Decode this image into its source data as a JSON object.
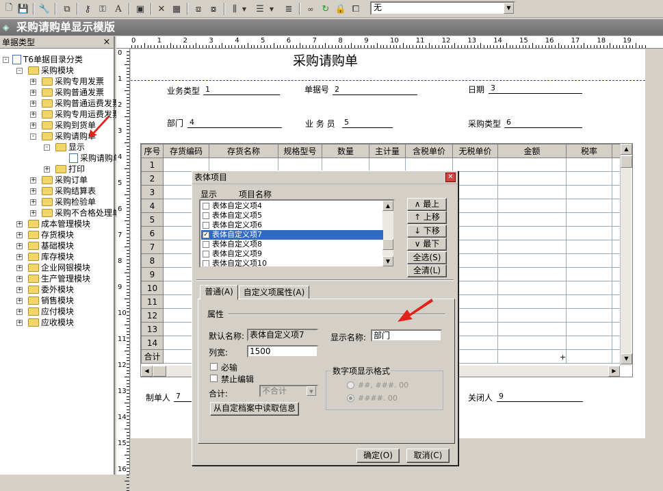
{
  "toolbar": {
    "combo_value": "无"
  },
  "window": {
    "title": "采购请购单显示模版"
  },
  "left_panel": {
    "header": "单据类型",
    "close_label": "×",
    "tree": [
      {
        "label": "T6单据目录分类",
        "level": 0,
        "type": "doc",
        "expand": "-"
      },
      {
        "label": "采购模块",
        "level": 1,
        "type": "folder",
        "expand": "-"
      },
      {
        "label": "采购专用发票",
        "level": 2,
        "type": "folder",
        "expand": "+"
      },
      {
        "label": "采购普通发票",
        "level": 2,
        "type": "folder",
        "expand": "+"
      },
      {
        "label": "采购普通运费发票",
        "level": 2,
        "type": "folder",
        "expand": "+"
      },
      {
        "label": "采购专用运费发票",
        "level": 2,
        "type": "folder",
        "expand": "+"
      },
      {
        "label": "采购到货单",
        "level": 2,
        "type": "folder",
        "expand": "+"
      },
      {
        "label": "采购请购单",
        "level": 2,
        "type": "folder",
        "expand": "-"
      },
      {
        "label": "显示",
        "level": 3,
        "type": "folder",
        "expand": "-"
      },
      {
        "label": "采购请购单",
        "level": 4,
        "type": "doc",
        "expand": ""
      },
      {
        "label": "打印",
        "level": 3,
        "type": "folder",
        "expand": "+"
      },
      {
        "label": "采购订单",
        "level": 2,
        "type": "folder",
        "expand": "+"
      },
      {
        "label": "采购结算表",
        "level": 2,
        "type": "folder",
        "expand": "+"
      },
      {
        "label": "采购检验单",
        "level": 2,
        "type": "folder",
        "expand": "+"
      },
      {
        "label": "采购不合格处理单",
        "level": 2,
        "type": "folder",
        "expand": "+"
      },
      {
        "label": "成本管理模块",
        "level": 1,
        "type": "folder",
        "expand": "+"
      },
      {
        "label": "存货模块",
        "level": 1,
        "type": "folder",
        "expand": "+"
      },
      {
        "label": "基础模块",
        "level": 1,
        "type": "folder",
        "expand": "+"
      },
      {
        "label": "库存模块",
        "level": 1,
        "type": "folder",
        "expand": "+"
      },
      {
        "label": "企业网银模块",
        "level": 1,
        "type": "folder",
        "expand": "+"
      },
      {
        "label": "生产管理模块",
        "level": 1,
        "type": "folder",
        "expand": "+"
      },
      {
        "label": "委外模块",
        "level": 1,
        "type": "folder",
        "expand": "+"
      },
      {
        "label": "销售模块",
        "level": 1,
        "type": "folder",
        "expand": "+"
      },
      {
        "label": "应付模块",
        "level": 1,
        "type": "folder",
        "expand": "+"
      },
      {
        "label": "应收模块",
        "level": 1,
        "type": "folder",
        "expand": "+"
      }
    ]
  },
  "ruler": {
    "top": [
      "0",
      "1",
      "2",
      "3",
      "4",
      "5",
      "6",
      "7",
      "8",
      "9",
      "10",
      "11",
      "12",
      "13",
      "14",
      "15",
      "16",
      "17",
      "18",
      "19"
    ],
    "left": [
      "0",
      "1",
      "2",
      "3",
      "4",
      "5",
      "6",
      "7",
      "8",
      "9",
      "10",
      "11",
      "12",
      "13",
      "14",
      "15",
      "16"
    ]
  },
  "form": {
    "title": "采购请购单",
    "header_fields": [
      {
        "label": "业务类型",
        "value": "1"
      },
      {
        "label": "单据号",
        "value": "2"
      },
      {
        "label": "日期",
        "value": "3"
      },
      {
        "label": "部门",
        "value": "4"
      },
      {
        "label": "业 务 员",
        "value": "5"
      },
      {
        "label": "采购类型",
        "value": "6"
      }
    ],
    "columns": [
      "序号",
      "存货编码",
      "存货名称",
      "规格型号",
      "数量",
      "主计量",
      "含税单价",
      "无税单价",
      "金额",
      "税率"
    ],
    "row_numbers": [
      "1",
      "2",
      "3",
      "4",
      "5",
      "6",
      "7",
      "8",
      "9",
      "10",
      "11",
      "12",
      "13",
      "14"
    ],
    "total_label": "合计",
    "total_marker": "+",
    "footer_fields": [
      {
        "label": "制单人",
        "value": "7"
      },
      {
        "label": "关闭人",
        "value": "9"
      }
    ]
  },
  "dialog": {
    "title": "表体项目",
    "col_show": "显示",
    "col_name": "项目名称",
    "items": [
      {
        "label": "表体自定义项4",
        "checked": false,
        "selected": false
      },
      {
        "label": "表体自定义项5",
        "checked": false,
        "selected": false
      },
      {
        "label": "表体自定义项6",
        "checked": false,
        "selected": false
      },
      {
        "label": "表体自定义项7",
        "checked": true,
        "selected": true
      },
      {
        "label": "表体自定义项8",
        "checked": false,
        "selected": false
      },
      {
        "label": "表体自定义项9",
        "checked": false,
        "selected": false
      },
      {
        "label": "表体自定义项10",
        "checked": false,
        "selected": false
      }
    ],
    "buttons": {
      "top": "∧ 最上",
      "up": "↑ 上移",
      "down": "↓ 下移",
      "bottom": "∨ 最下",
      "select_all": "全选(S)",
      "clear_all": "全清(L)"
    },
    "tabs": [
      "普通(A)",
      "自定义项属性(A)"
    ],
    "group_title": "属性",
    "default_name_label": "默认名称:",
    "default_name_value": "表体自定义项7",
    "display_name_label": "显示名称:",
    "display_name_value": "部门",
    "col_width_label": "列宽:",
    "col_width_value": "1500",
    "required_label": "必输",
    "no_edit_label": "禁止编辑",
    "total_label": "合计:",
    "total_value": "不合计",
    "numfmt_title": "数字项显示格式",
    "numfmt_opt1": "##, ###. 00",
    "numfmt_opt2": "####. 00",
    "read_archive_btn": "从自定档案中读取信息",
    "ok": "确定(O)",
    "cancel": "取消(C)"
  }
}
